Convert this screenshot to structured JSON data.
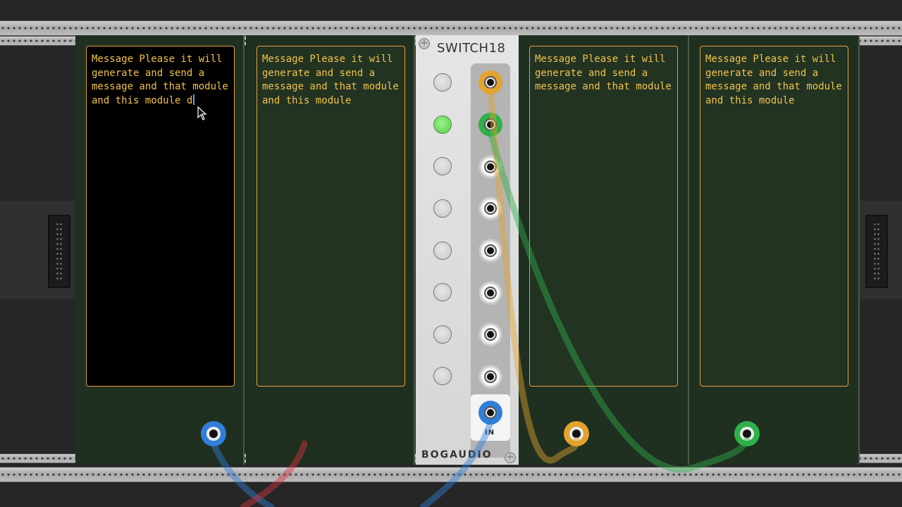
{
  "notes": [
    {
      "text": "Message Please it will generate and send a message and that module and this module d"
    },
    {
      "text": "Message Please it will generate and send a message and that module and this module"
    },
    {
      "text": "Message Please it will generate and send a message and that module"
    },
    {
      "text": "Message Please it will generate and send a message and that module and this module"
    }
  ],
  "switch_module": {
    "title": "SWITCH18",
    "brand": "BOGAUDIO",
    "in_label": "IN",
    "active_channel": 2,
    "channel_count": 8
  },
  "colors": {
    "panel_green": "#1f2f20",
    "note_text": "#f2c24a",
    "note_border": "#e6a23a",
    "cable_blue": "#2f7fd8",
    "cable_red": "#d8353e",
    "cable_orange": "#e3a32e",
    "cable_green": "#2fb04a",
    "led_on": "#6ce25a"
  },
  "icons": {
    "screw": "screw-icon",
    "cursor": "mouse-pointer-icon"
  }
}
